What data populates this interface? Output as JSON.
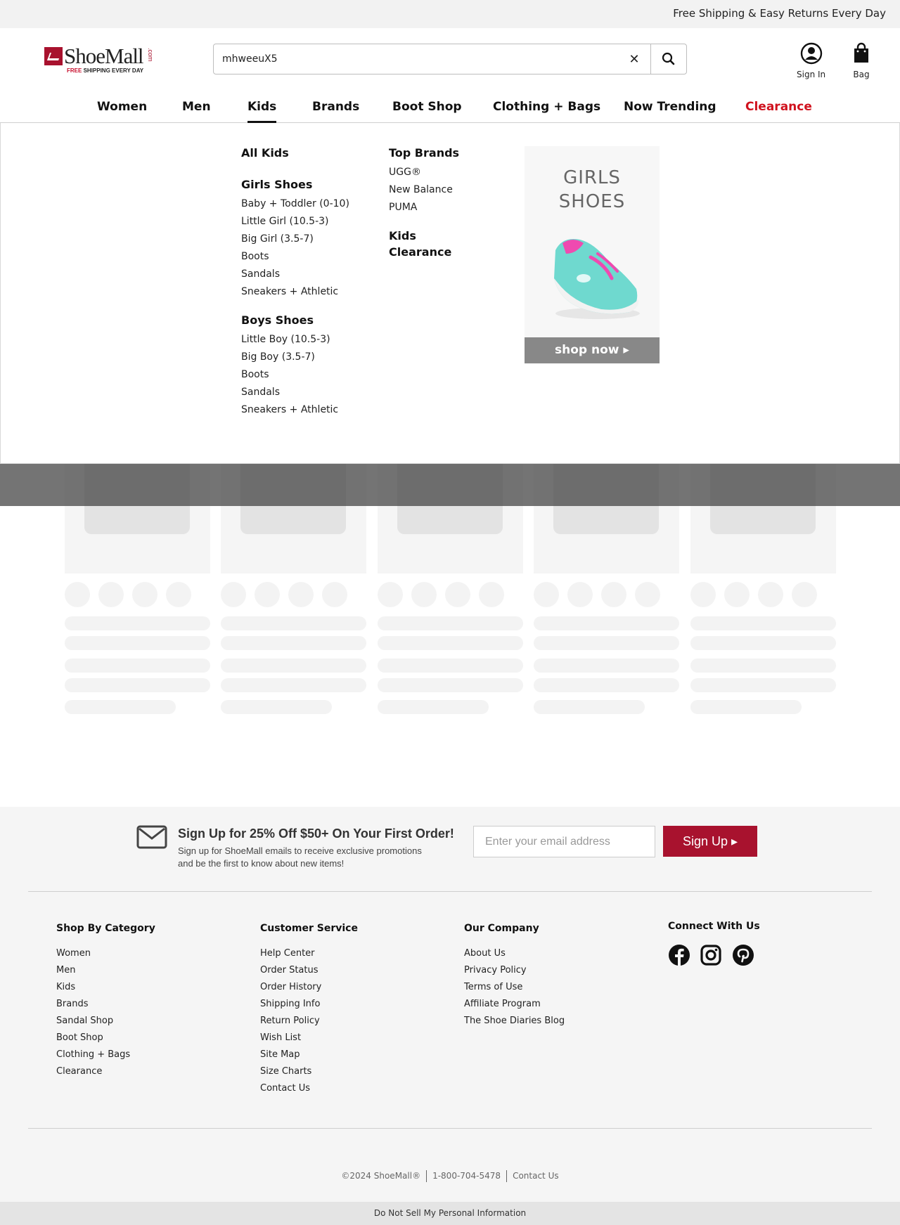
{
  "topbar": {
    "promo": "Free Shipping & Easy Returns Every Day"
  },
  "header": {
    "logo_word": "ShoeMall",
    "logo_com": ".com",
    "logo_tag_free": "FREE",
    "logo_tag_rest": " SHIPPING EVERY DAY",
    "search_value": "mhweeuX5",
    "sign_in": "Sign In",
    "bag": "Bag"
  },
  "nav": {
    "items": [
      "Women",
      "Men",
      "Kids",
      "Brands",
      "Boot Shop",
      "Clothing + Bags",
      "Now Trending",
      "Clearance"
    ],
    "active": "Kids"
  },
  "dropdown": {
    "all_kids": "All Kids",
    "girls": {
      "title": "Girls Shoes",
      "links": [
        "Baby + Toddler (0-10)",
        "Little Girl (10.5-3)",
        "Big Girl (3.5-7)",
        "Boots",
        "Sandals",
        "Sneakers + Athletic"
      ]
    },
    "boys": {
      "title": "Boys Shoes",
      "links": [
        "Little Boy (10.5-3)",
        "Big Boy (3.5-7)",
        "Boots",
        "Sandals",
        "Sneakers + Athletic"
      ]
    },
    "top_brands": {
      "title": "Top Brands",
      "links": [
        "UGG®",
        "New Balance",
        "PUMA"
      ]
    },
    "kids_clearance_1": "Kids",
    "kids_clearance_2": "Clearance",
    "promo": {
      "line1": "GIRLS",
      "line2": "SHOES",
      "cta": "shop now ▸"
    }
  },
  "newsletter": {
    "headline": "Sign Up for 25% Off $50+ On Your First Order!",
    "sub": "Sign up for ShoeMall emails to receive exclusive promotions and be the first to know about new items!",
    "placeholder": "Enter your email address",
    "button": "Sign Up ▸"
  },
  "footer": {
    "shop": {
      "title": "Shop By Category",
      "links": [
        "Women",
        "Men",
        "Kids",
        "Brands",
        "Sandal Shop",
        "Boot Shop",
        "Clothing + Bags",
        "Clearance"
      ]
    },
    "service": {
      "title": "Customer Service",
      "links": [
        "Help Center",
        "Order Status",
        "Order History",
        "Shipping Info",
        "Return Policy",
        "Wish List",
        "Site Map",
        "Size Charts",
        "Contact Us"
      ]
    },
    "company": {
      "title": "Our Company",
      "links": [
        "About Us",
        "Privacy Policy",
        "Terms of Use",
        "Affiliate Program",
        "The Shoe Diaries Blog"
      ]
    },
    "connect": {
      "title": "Connect With Us",
      "icons": [
        "facebook-icon",
        "instagram-icon",
        "pinterest-icon"
      ]
    },
    "copyright": "©2024 ShoeMall®",
    "phone": "1-800-704-5478",
    "contact": "Contact Us",
    "dns": "Do Not Sell My Personal Information"
  },
  "colors": {
    "brand": "#a8122e",
    "clearance": "#d0121e",
    "shoe_teal": "#6fd9cf",
    "shoe_pink": "#ef4ab0"
  }
}
